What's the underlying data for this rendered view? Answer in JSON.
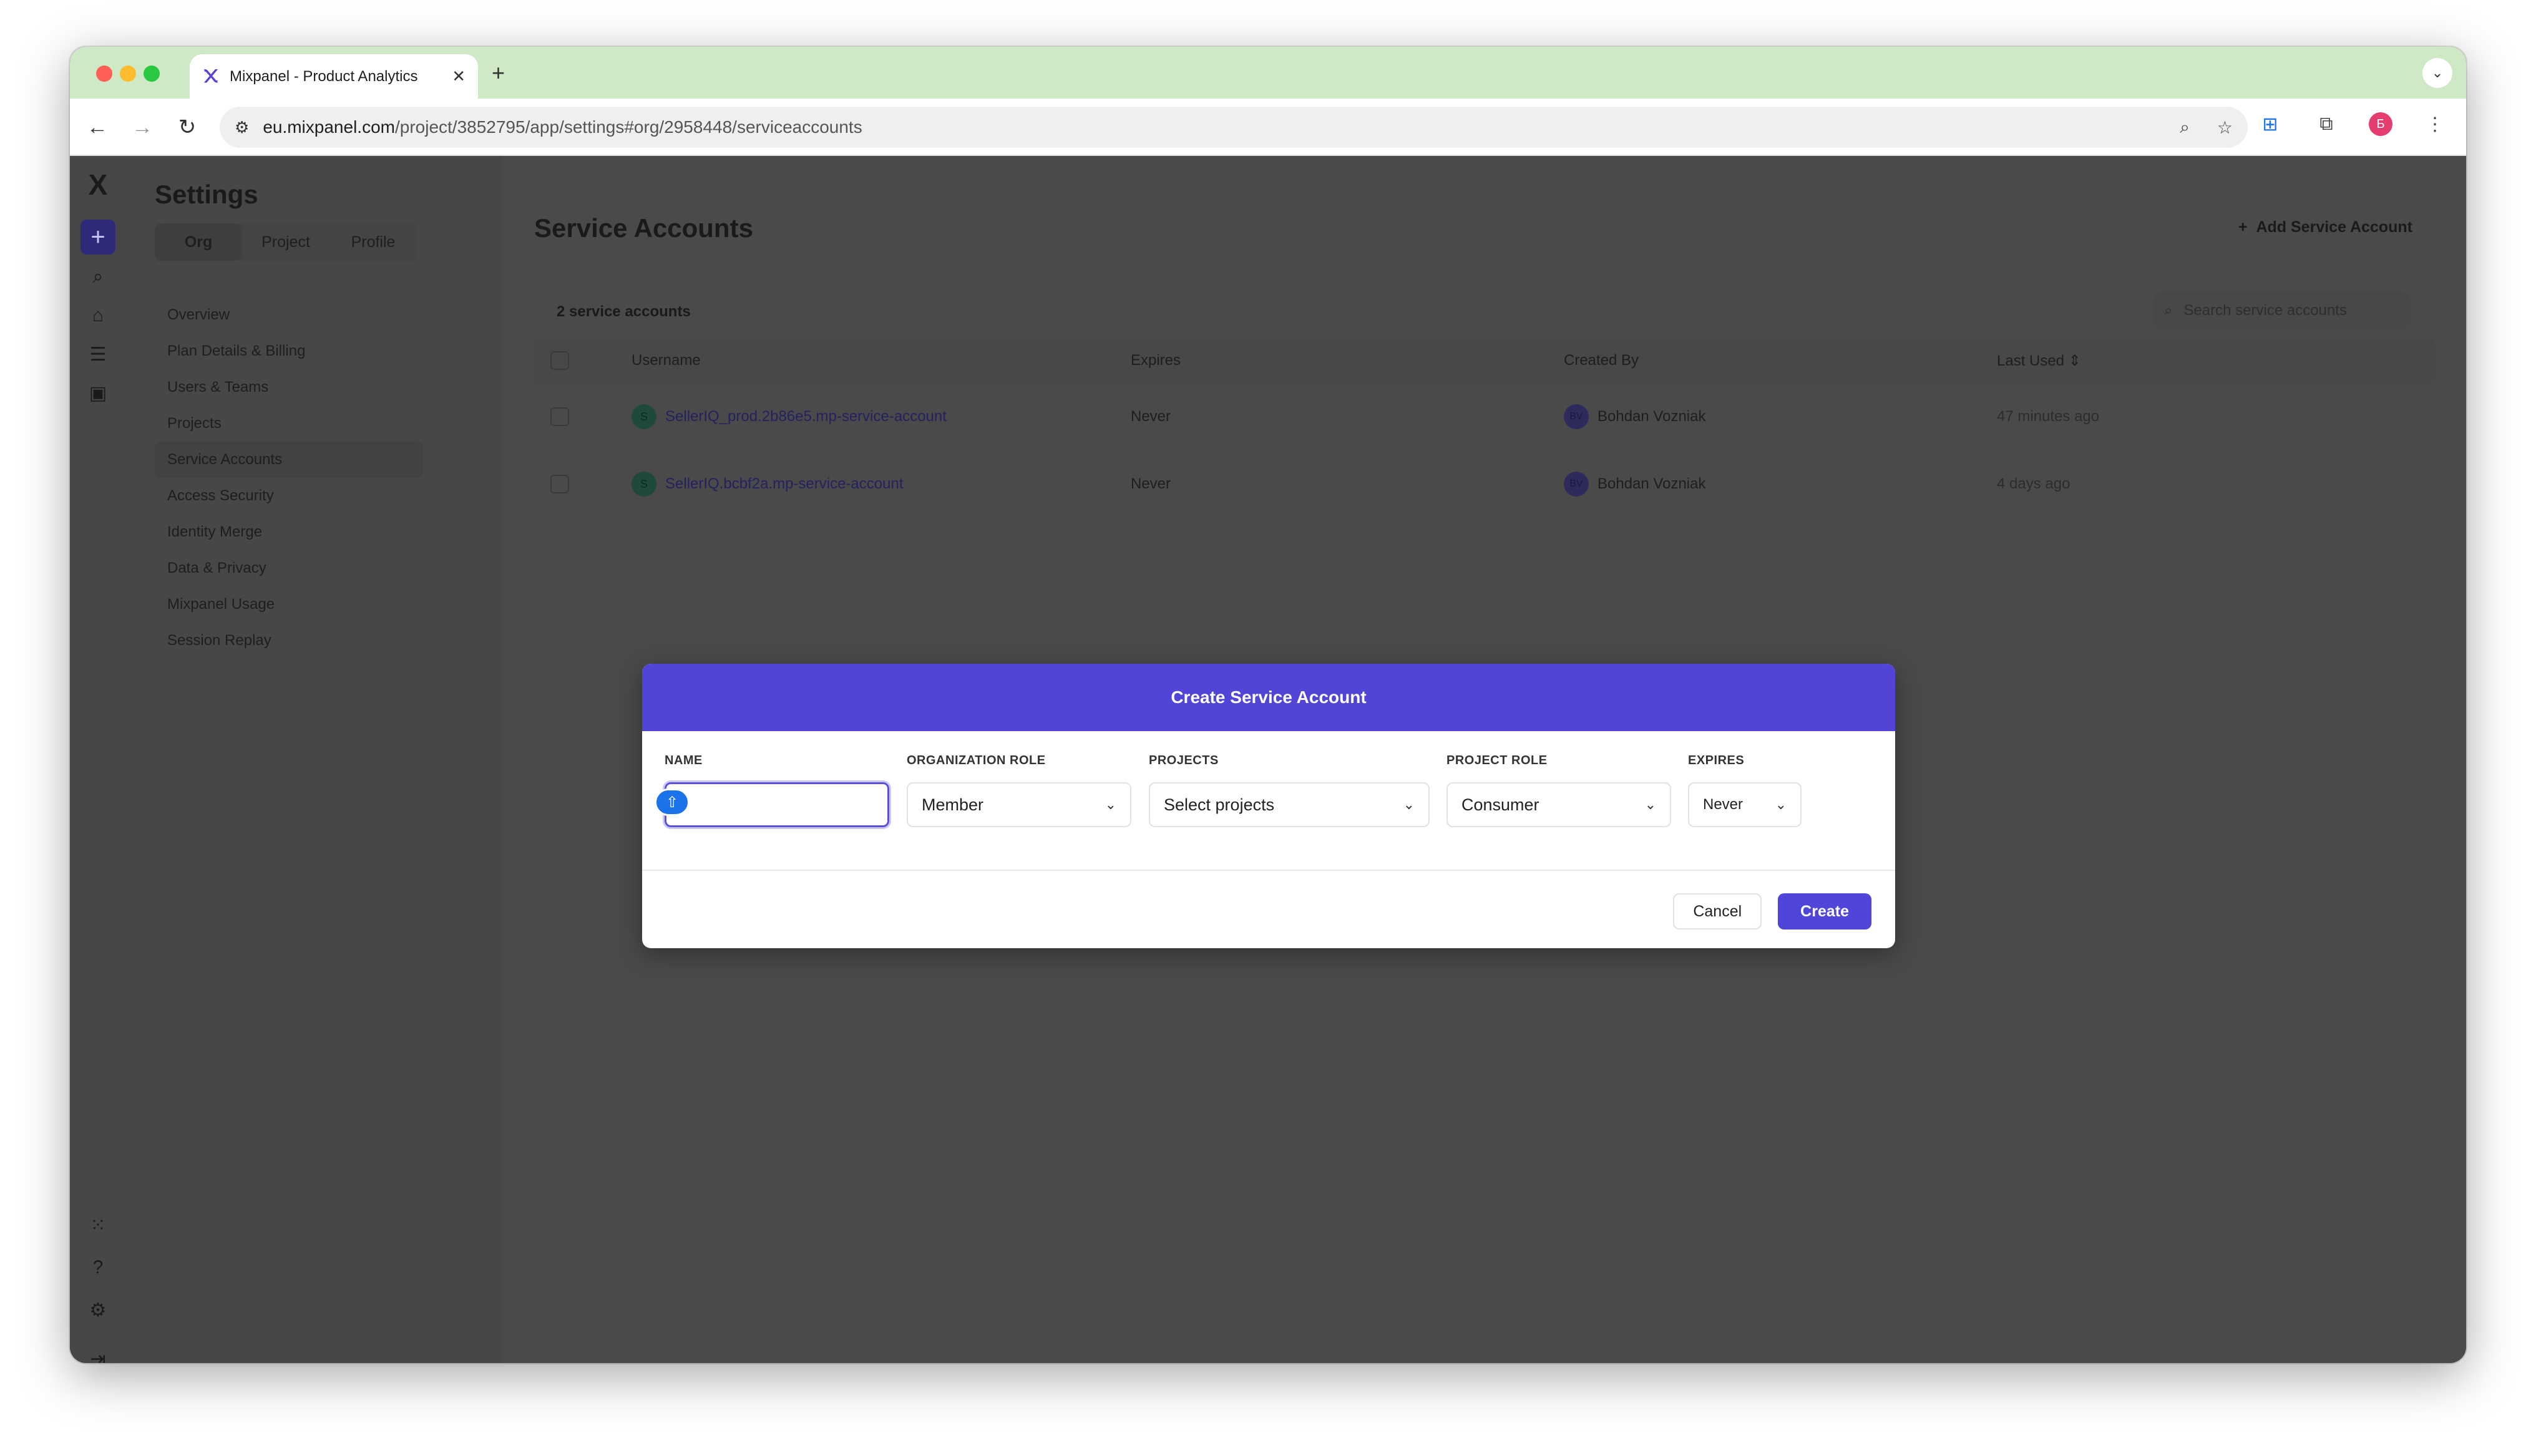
{
  "browser": {
    "tab_title": "Mixpanel - Product Analytics",
    "url_host": "eu.mixpanel.com",
    "url_path": "/project/3852795/app/settings#org/2958448/serviceaccounts",
    "profile_initial": "Б"
  },
  "settings": {
    "title": "Settings",
    "tabs": [
      {
        "label": "Org",
        "active": true
      },
      {
        "label": "Project",
        "active": false
      },
      {
        "label": "Profile",
        "active": false
      }
    ],
    "nav": [
      {
        "label": "Overview"
      },
      {
        "label": "Plan Details & Billing"
      },
      {
        "label": "Users & Teams"
      },
      {
        "label": "Projects"
      },
      {
        "label": "Service Accounts",
        "active": true
      },
      {
        "label": "Access Security"
      },
      {
        "label": "Identity Merge"
      },
      {
        "label": "Data & Privacy"
      },
      {
        "label": "Mixpanel Usage"
      },
      {
        "label": "Session Replay"
      }
    ]
  },
  "main": {
    "title": "Service Accounts",
    "add_button": "Add Service Account",
    "count_label": "2 service accounts",
    "search_placeholder": "Search service accounts",
    "columns": [
      "Username",
      "Expires",
      "Created By",
      "Last Used"
    ],
    "rows": [
      {
        "avatar": "S",
        "username": "SellerIQ_prod.2b86e5.mp-service-account",
        "expires": "Never",
        "creator_initials": "BV",
        "created_by": "Bohdan Vozniak",
        "last_used": "47 minutes ago"
      },
      {
        "avatar": "S",
        "username": "SellerIQ.bcbf2a.mp-service-account",
        "expires": "Never",
        "creator_initials": "BV",
        "created_by": "Bohdan Vozniak",
        "last_used": "4 days ago"
      }
    ]
  },
  "modal": {
    "title": "Create Service Account",
    "name_label": "NAME",
    "name_value": "",
    "org_role_label": "ORGANIZATION ROLE",
    "org_role_value": "Member",
    "projects_label": "PROJECTS",
    "projects_value": "Select projects",
    "project_role_label": "PROJECT ROLE",
    "project_role_value": "Consumer",
    "expires_label": "EXPIRES",
    "expires_value": "Never",
    "cancel_label": "Cancel",
    "create_label": "Create"
  },
  "colors": {
    "accent": "#5145d8",
    "create_button": "#4f46d9",
    "overlay": "#4a4a4a",
    "tabstrip": "#cfe8c5"
  }
}
